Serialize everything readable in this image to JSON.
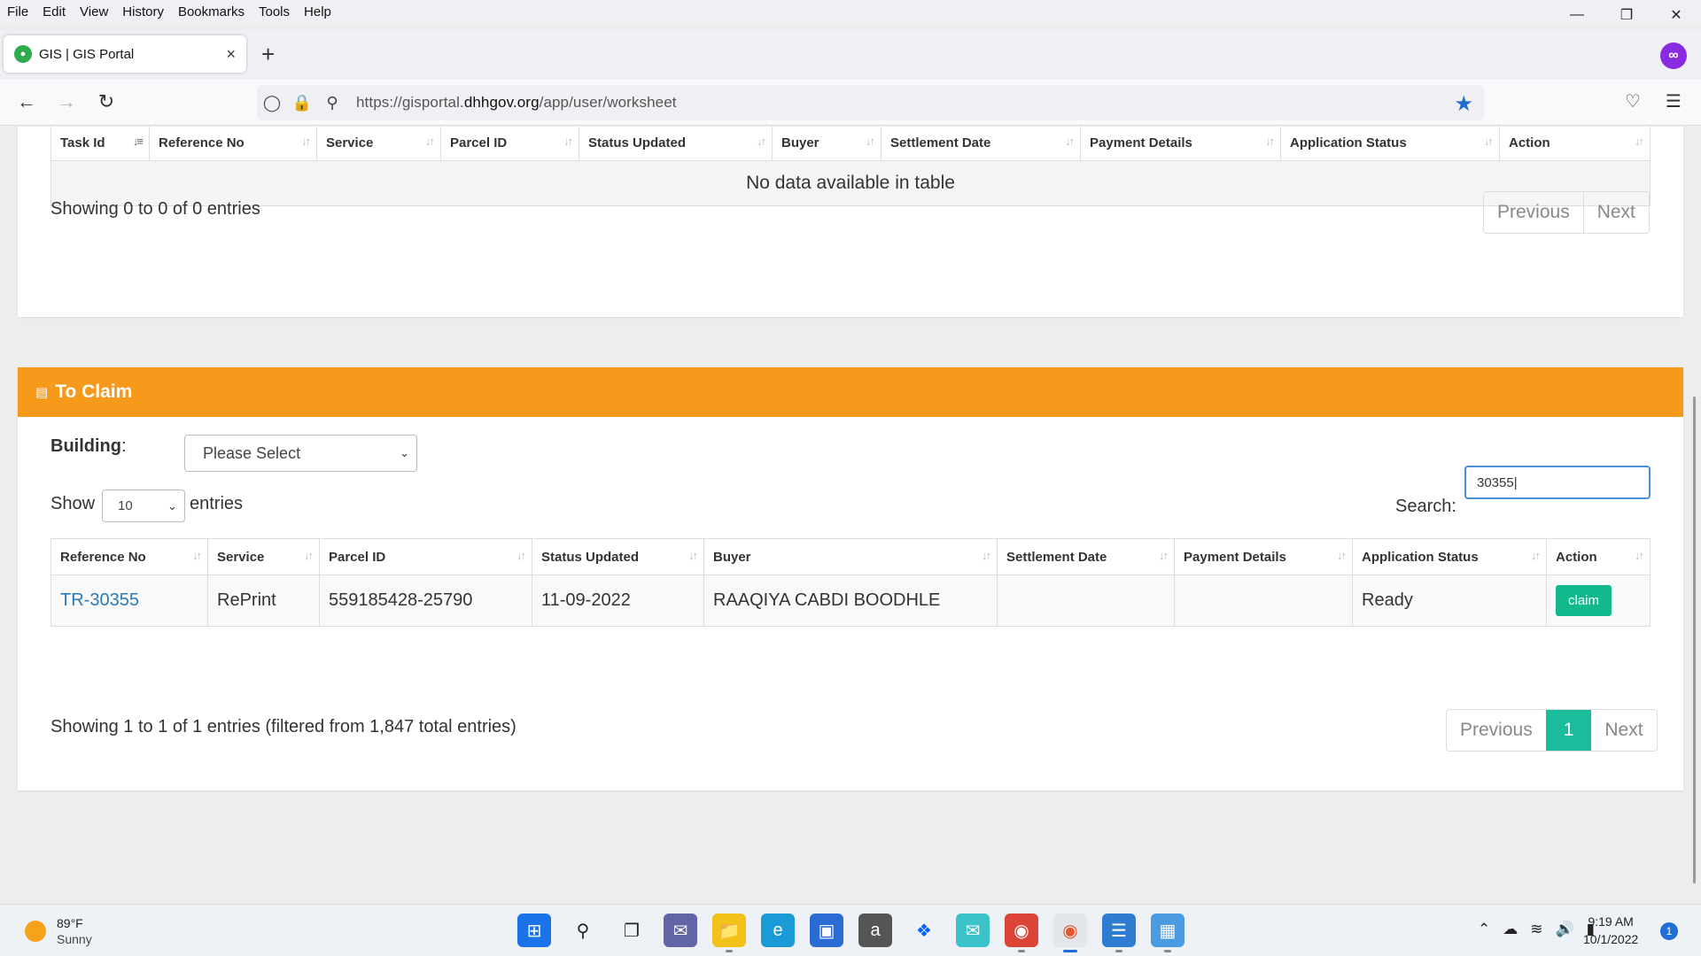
{
  "menu": [
    "File",
    "Edit",
    "View",
    "History",
    "Bookmarks",
    "Tools",
    "Help"
  ],
  "window_controls": {
    "minimize_icon": "minimize-icon",
    "restore_icon": "restore-icon",
    "close_icon": "close-icon"
  },
  "tab": {
    "title": "GIS | GIS Portal",
    "favicon": "gis-favicon-icon"
  },
  "url": {
    "prefix": "https://gisportal.",
    "domain": "dhhgov.org",
    "path": "/app/user/worksheet"
  },
  "table1": {
    "columns": [
      "Task Id",
      "Reference No",
      "Service",
      "Parcel ID",
      "Status Updated",
      "Buyer",
      "Settlement Date",
      "Payment Details",
      "Application Status",
      "Action"
    ],
    "empty_message": "No data available in table",
    "info": "Showing 0 to 0 of 0 entries",
    "pager": {
      "previous": "Previous",
      "next": "Next"
    }
  },
  "claim": {
    "title": "To Claim",
    "building_label": "Building",
    "building_colon": ":",
    "building_select": "Please Select",
    "show_label": "Show",
    "entries_value": "10",
    "entries_label": "entries",
    "search_label": "Search:",
    "search_value": "30355",
    "columns": [
      "Reference No",
      "Service",
      "Parcel ID",
      "Status Updated",
      "Buyer",
      "Settlement Date",
      "Payment Details",
      "Application Status",
      "Action"
    ],
    "rows": [
      {
        "reference_no": "TR-30355",
        "service": "RePrint",
        "parcel_id": "559185428-25790",
        "status_updated": "11-09-2022",
        "buyer": "RAAQIYA CABDI BOODHLE",
        "settlement_date": "",
        "payment_details": "",
        "application_status": "Ready",
        "action": "claim"
      }
    ],
    "info": "Showing 1 to 1 of 1 entries (filtered from 1,847 total entries)",
    "pager": {
      "previous": "Previous",
      "current": "1",
      "next": "Next"
    }
  },
  "taskbar": {
    "weather_temp": "89°F",
    "weather_cond": "Sunny",
    "time": "9:19 AM",
    "date": "10/1/2022",
    "notifications": "1"
  },
  "colors": {
    "accent": "#f7991b",
    "claim_button": "#12b98d",
    "pager_current": "#1abc9c",
    "link": "#2a7ab8"
  }
}
